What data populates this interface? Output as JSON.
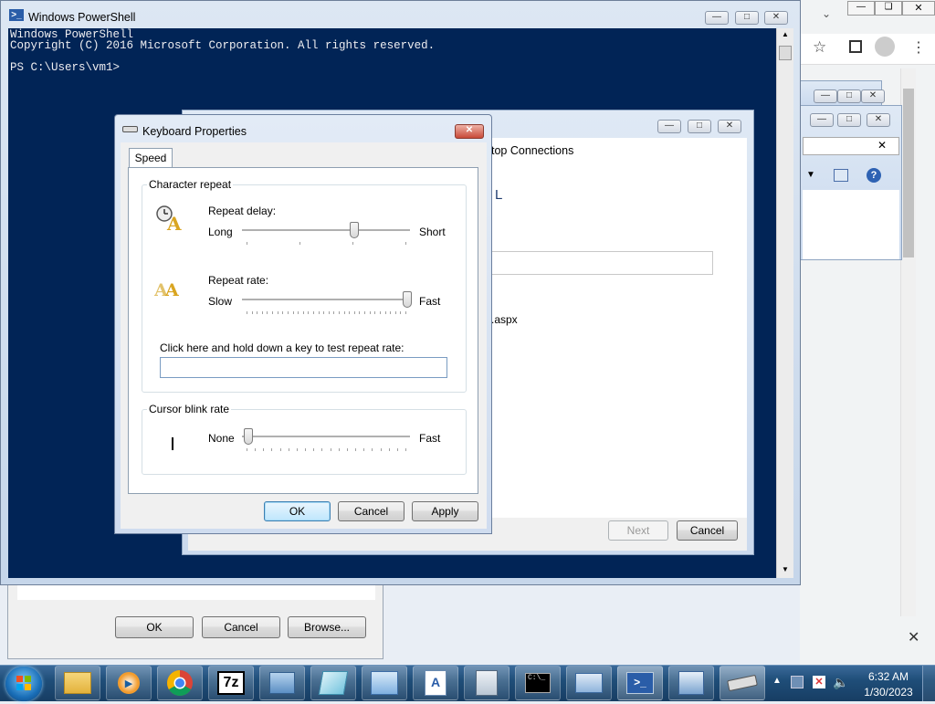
{
  "powershell": {
    "title": "Windows PowerShell",
    "lines": [
      "Windows PowerShell",
      "Copyright (C) 2016 Microsoft Corporation. All rights reserved.",
      "",
      "PS C:\\Users\\vm1>"
    ],
    "bg_color": "#012456"
  },
  "wizard": {
    "heading_fragment": "top Connections",
    "letter_fragment": "L",
    "aspx_fragment": ".aspx",
    "next_label": "Next",
    "cancel_label": "Cancel"
  },
  "back_dialog": {
    "ok_label": "OK",
    "cancel_label": "Cancel",
    "browse_label": "Browse..."
  },
  "keyboard": {
    "title": "Keyboard Properties",
    "tab_speed": "Speed",
    "char_repeat_group": "Character repeat",
    "repeat_delay_label": "Repeat delay:",
    "repeat_delay_min": "Long",
    "repeat_delay_max": "Short",
    "repeat_delay_value": 0.667,
    "repeat_rate_label": "Repeat rate:",
    "repeat_rate_min": "Slow",
    "repeat_rate_max": "Fast",
    "repeat_rate_value": 1.0,
    "test_label": "Click here and hold down a key to test repeat rate:",
    "test_value": "",
    "cursor_group": "Cursor blink rate",
    "blink_min": "None",
    "blink_max": "Fast",
    "blink_value": 0.0,
    "ok_label": "OK",
    "cancel_label": "Cancel",
    "apply_label": "Apply"
  },
  "taskbar": {
    "start_label": "Start",
    "time": "6:32 AM",
    "date": "1/30/2023",
    "apps": [
      "explorer-icon",
      "media-player-icon",
      "chrome-icon",
      "7zip-icon",
      "remote-desktop-icon",
      "notepad-icon",
      "control-panel-icon",
      "wordpad-icon",
      "calculator-icon",
      "cmd-icon",
      "server-manager-icon",
      "powershell-icon",
      "network-setup-icon",
      "keyboard-icon"
    ],
    "icon_7zip_text": "7z"
  },
  "colors": {
    "taskbar": "#1f4e79",
    "accent": "#3c7fb1"
  }
}
